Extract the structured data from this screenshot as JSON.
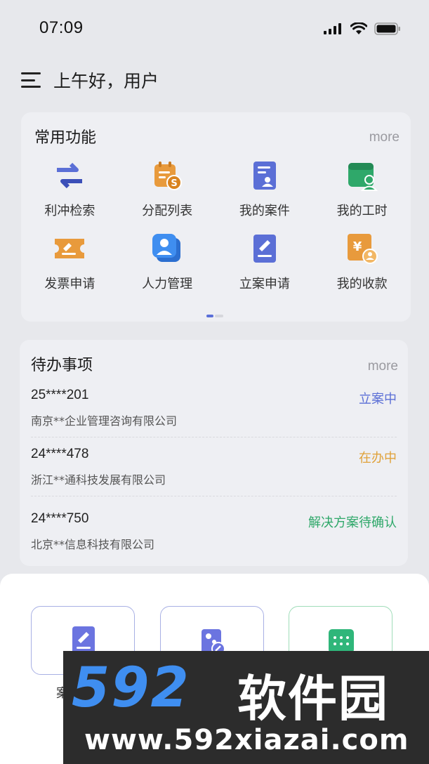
{
  "status_bar": {
    "time": "07:09"
  },
  "header": {
    "greeting": "上午好，用户"
  },
  "features": {
    "title": "常用功能",
    "more": "more",
    "items": [
      {
        "label": "利冲检索",
        "icon": "swap-arrows-icon",
        "color": "#5b6fd6"
      },
      {
        "label": "分配列表",
        "icon": "calendar-money-icon",
        "color": "#e89a3c"
      },
      {
        "label": "我的案件",
        "icon": "case-file-icon",
        "color": "#5b6fd6"
      },
      {
        "label": "我的工时",
        "icon": "calendar-person-icon",
        "color": "#2fa86a"
      },
      {
        "label": "发票申请",
        "icon": "invoice-ticket-icon",
        "color": "#e89a3c"
      },
      {
        "label": "人力管理",
        "icon": "person-card-icon",
        "color": "#3f8ef0"
      },
      {
        "label": "立案申请",
        "icon": "document-pen-icon",
        "color": "#5b6fd6"
      },
      {
        "label": "我的收款",
        "icon": "yen-receipt-icon",
        "color": "#e89a3c"
      }
    ]
  },
  "todos": {
    "title": "待办事项",
    "more": "more",
    "items": [
      {
        "id": "25****201",
        "company": "南京**企业管理咨询有限公司",
        "status": "立案中",
        "status_color": "#5b6fd6"
      },
      {
        "id": "24****478",
        "company": "浙江**通科技发展有限公司",
        "status": "在办中",
        "status_color": "#e0a23a"
      },
      {
        "id": "24****750",
        "company": "北京**信息科技有限公司",
        "status": "解决方案待确认",
        "status_color": "#2fa86a"
      }
    ]
  },
  "sheet": {
    "actions": [
      {
        "icon": "document-pen-icon",
        "label": "案"
      },
      {
        "icon": "case-link-icon",
        "label": ""
      },
      {
        "icon": "calendar-grid-icon",
        "label": ""
      }
    ]
  },
  "watermark": {
    "brand_num": "592",
    "brand_cn": "软件园",
    "url": "www.592xiazai.com"
  }
}
